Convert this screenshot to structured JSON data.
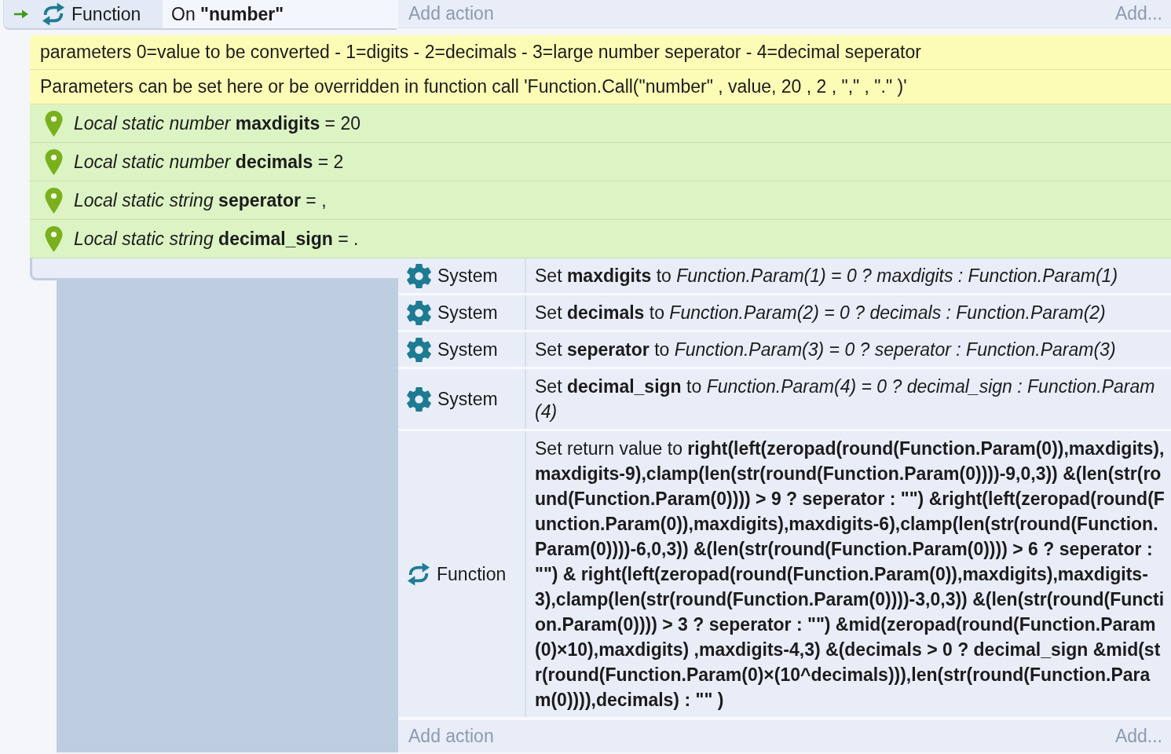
{
  "event": {
    "trigger": {
      "kind": "function",
      "object": "Function",
      "condition": "On **\"number\"**"
    },
    "add_action": {
      "label": "Add action",
      "more": "Add..."
    }
  },
  "comments": [
    "parameters 0=value to be converted - 1=digits - 2=decimals - 3=large number seperator - 4=decimal seperator",
    "Parameters can be set here or be overridden in function call 'Function.Call(\"number\" , value, 20 , 2 , \",\" , \".\" )'"
  ],
  "local_variables": [
    "*Local static number* **maxdigits** = 20",
    "*Local static number* **decimals** = 2",
    "*Local static string* **seperator** = ,",
    "*Local static string* **decimal_sign** = ."
  ],
  "actions": [
    {
      "kind": "system",
      "object": "System",
      "text": "Set **maxdigits** to *Function.Param(1) = 0 ? maxdigits : Function.Param(1)*"
    },
    {
      "kind": "system",
      "object": "System",
      "text": "Set **decimals** to *Function.Param(2) = 0 ? decimals : Function.Param(2)*"
    },
    {
      "kind": "system",
      "object": "System",
      "text": "Set **seperator** to *Function.Param(3) = 0 ? seperator : Function.Param(3)*"
    },
    {
      "kind": "system",
      "object": "System",
      "text": "Set **decimal_sign** to *Function.Param(4) = 0 ? decimal_sign : Function.Param(4)*"
    },
    {
      "kind": "function",
      "object": "Function",
      "text": "Set return value to **right(left(zeropad(round(Function.Param(0)),maxdigits),maxdigits-9),clamp(len(str(round(Function.Param(0))))-9,0,3)) &(len(str(round(Function.Param(0)))) > 9 ? seperator : \"\") &right(left(zeropad(round(Function.Param(0)),maxdigits),maxdigits-6),clamp(len(str(round(Function.Param(0))))-6,0,3)) &(len(str(round(Function.Param(0)))) > 6 ? seperator : \"\") & right(left(zeropad(round(Function.Param(0)),maxdigits),maxdigits-3),clamp(len(str(round(Function.Param(0))))-3,0,3)) &(len(str(round(Function.Param(0)))) > 3 ? seperator : \"\") &mid(zeropad(round(Function.Param(0)×10),maxdigits) ,maxdigits-4,3) &(decimals > 0 ? decimal_sign &mid(str(round(Function.Param(0)×(10^decimals))),len(str(round(Function.Param(0)))),decimals) : \"\" )**"
    }
  ],
  "add_action": {
    "label": "Add action",
    "more": "Add..."
  }
}
